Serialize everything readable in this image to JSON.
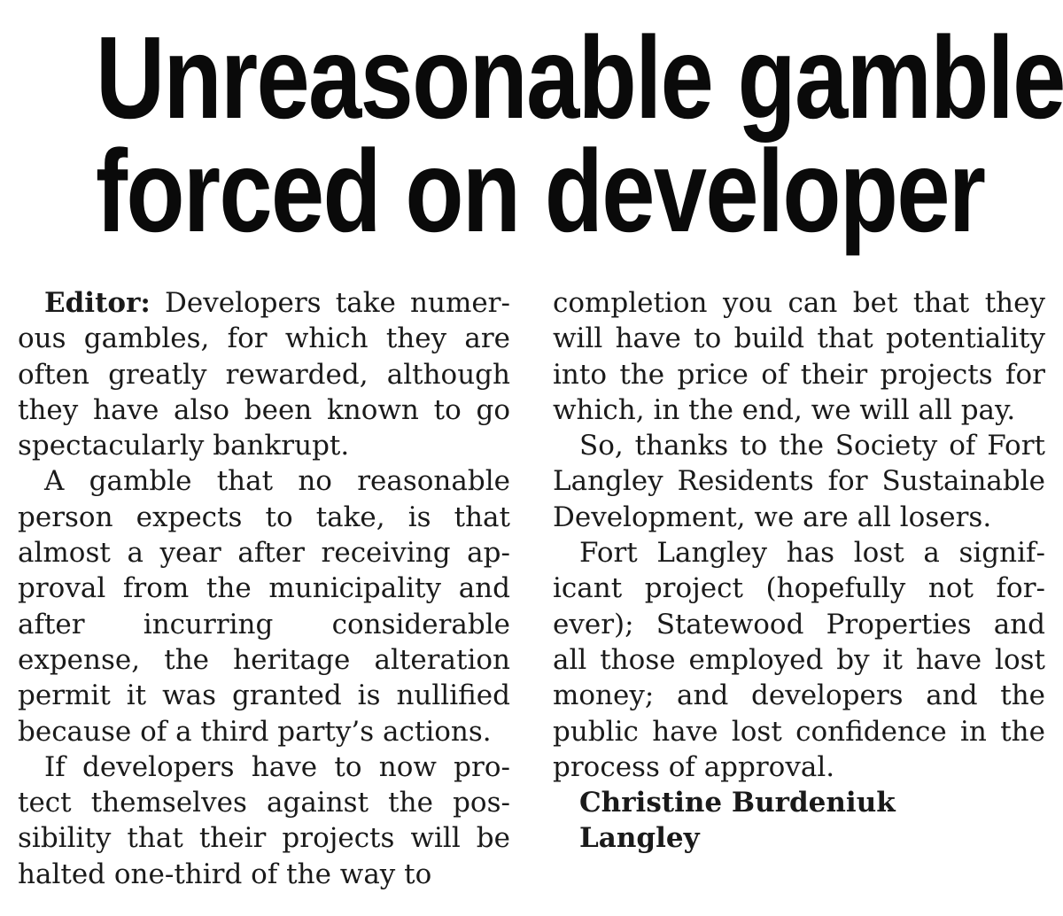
{
  "headline": {
    "line1": "Unreasonable gamble",
    "line2": "forced on developer"
  },
  "letter": {
    "salutation": "Editor:",
    "paragraphs": [
      " Developers take numer­ous gambles, for which they are often greatly rewarded, although they have also been known to go spectacularly bankrupt.",
      "A gamble that no reasonable person expects to take, is that almost a year after receiving ap­proval from the municipality and after incurring considerable expense, the heritage alteration permit it was granted is nullified because of a third party’s actions.",
      "If developers have to now pro­tect themselves against the pos­sibility that their projects will be halted one-third of the way to",
      "completion you can bet that they will have to build that potentiali­ty into the price of their projects for which, in the end, we will all pay.",
      "So, thanks to the Society of Fort Langley Residents for Sustainable Development, we are all losers.",
      "Fort Langley has lost a signif­icant project (hopefully not for­ever); Statewood Properties and all those employed by it have lost money; and developers and the public have lost confidence in the process of approval."
    ],
    "signature_name": "Christine Burdeniuk",
    "signature_place": "Langley"
  }
}
